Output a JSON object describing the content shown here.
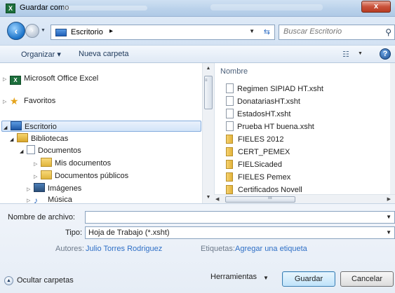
{
  "window": {
    "title": "Guardar como",
    "close_glyph": "x"
  },
  "address_bar": {
    "location": "Escritorio",
    "separator": "▸",
    "search_placeholder": "Buscar Escritorio"
  },
  "toolbar": {
    "organize_label": "Organizar ▾",
    "new_folder_label": "Nueva carpeta"
  },
  "nav_pane": {
    "items": [
      {
        "label": "Microsoft Office Excel"
      },
      {
        "label": "Favoritos"
      },
      {
        "label": "Escritorio"
      },
      {
        "label": "Bibliotecas"
      },
      {
        "label": "Documentos"
      },
      {
        "label": "Mis documentos"
      },
      {
        "label": "Documentos públicos"
      },
      {
        "label": "Imágenes"
      },
      {
        "label": "Música"
      }
    ]
  },
  "file_pane": {
    "column_header": "Nombre",
    "files": [
      {
        "name": "Regimen SIPIAD HT.xsht",
        "type": "file"
      },
      {
        "name": "DonatariasHT.xsht",
        "type": "file"
      },
      {
        "name": "EstadosHT.xsht",
        "type": "file"
      },
      {
        "name": "Prueba HT buena.xsht",
        "type": "file"
      },
      {
        "name": "FIELES 2012",
        "type": "folder"
      },
      {
        "name": "CERT_PEMEX",
        "type": "folder"
      },
      {
        "name": "FIELSicaded",
        "type": "folder"
      },
      {
        "name": "FIELES Pemex",
        "type": "folder"
      },
      {
        "name": "Certificados Novell",
        "type": "folder"
      }
    ]
  },
  "form": {
    "filename_label": "Nombre de archivo:",
    "filename_value": "",
    "type_label": "Tipo:",
    "type_value": "Hoja de Trabajo (*.xsht)",
    "authors_label": "Autores:",
    "authors_value": "Julio Torres Rodriguez",
    "tags_label": "Etiquetas:",
    "tags_value": "Agregar una etiqueta"
  },
  "footer": {
    "hide_folders_label": "Ocultar carpetas",
    "tools_label": "Herramientas",
    "save_label": "Guardar",
    "cancel_label": "Cancelar"
  }
}
